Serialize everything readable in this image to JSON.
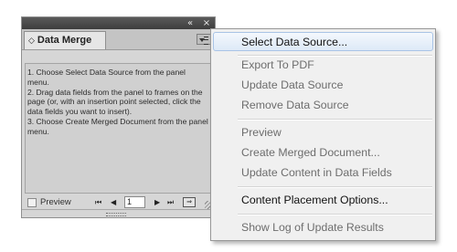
{
  "panel": {
    "collapse_icon": "«",
    "close_icon": "×",
    "tab_icon": "◇",
    "tab_label": "Data Merge",
    "instructions": [
      "1. Choose Select Data Source from the panel menu.",
      "2. Drag data fields from the panel to frames on the page (or, with an insertion point selected, click the data fields you want to insert).",
      "3. Choose Create Merged Document from the panel menu."
    ],
    "preview_label": "Preview",
    "page_value": "1",
    "nav": {
      "first": "⏮",
      "prev": "◀",
      "next": "▶",
      "last": "⏭"
    },
    "create_doc_icon": "⇒"
  },
  "menu": {
    "items": [
      {
        "label": "Select Data Source...",
        "enabled": true
      },
      {
        "label": "Export To PDF",
        "enabled": false
      },
      {
        "label": "Update Data Source",
        "enabled": false
      },
      {
        "label": "Remove Data Source",
        "enabled": false
      },
      {
        "label": "Preview",
        "enabled": false
      },
      {
        "label": "Create Merged Document...",
        "enabled": false
      },
      {
        "label": "Update Content in Data Fields",
        "enabled": false
      },
      {
        "label": "Content Placement Options...",
        "enabled": true
      },
      {
        "label": "Show Log of Update Results",
        "enabled": false
      }
    ]
  }
}
